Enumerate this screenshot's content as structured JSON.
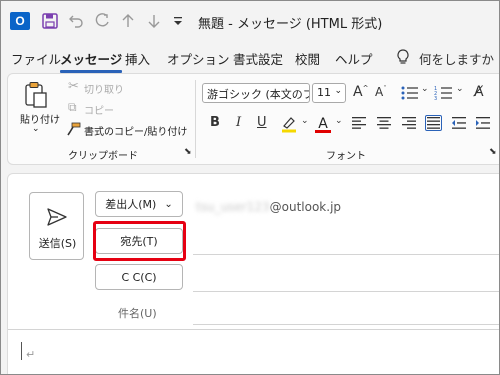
{
  "window": {
    "title": "無題 - メッセージ (HTML 形式)",
    "app_logo_letter": "O"
  },
  "quick_access": {
    "icons": [
      "save-icon",
      "undo-icon",
      "redo-icon",
      "up-arrow-icon",
      "down-arrow-icon",
      "customize-icon"
    ]
  },
  "menu": {
    "items": [
      "ファイル",
      "メッセージ",
      "挿入",
      "オプション",
      "書式設定",
      "校閲",
      "ヘルプ"
    ],
    "active": "メッセージ",
    "tell_me": "何をしますか"
  },
  "clipboard_group": {
    "label": "クリップボード",
    "paste_label": "貼り付け",
    "cut_label": "切り取り",
    "copy_label": "コピー",
    "format_painter_label": "書式のコピー/貼り付け"
  },
  "font_group": {
    "label": "フォント",
    "font_name": "游ゴシック (本文のフォ",
    "font_size": "11",
    "bold": "B",
    "italic": "I",
    "underline": "U",
    "grow_font": "A",
    "shrink_font": "A",
    "font_color_letter": "A",
    "highlight_color": "#f5d800",
    "font_color": "#e00000"
  },
  "compose": {
    "send_label": "送信(S)",
    "from_button": "差出人(M)",
    "to_button": "宛先(T)",
    "cc_button": "C C(C)",
    "from_account_blurred": "tsu_user123",
    "from_domain": "@outlook.jp",
    "subject_label": "件名(U)",
    "paragraph_mark": "↵"
  },
  "colors": {
    "accent": "#2a62b8",
    "highlight_box": "#e60012"
  }
}
